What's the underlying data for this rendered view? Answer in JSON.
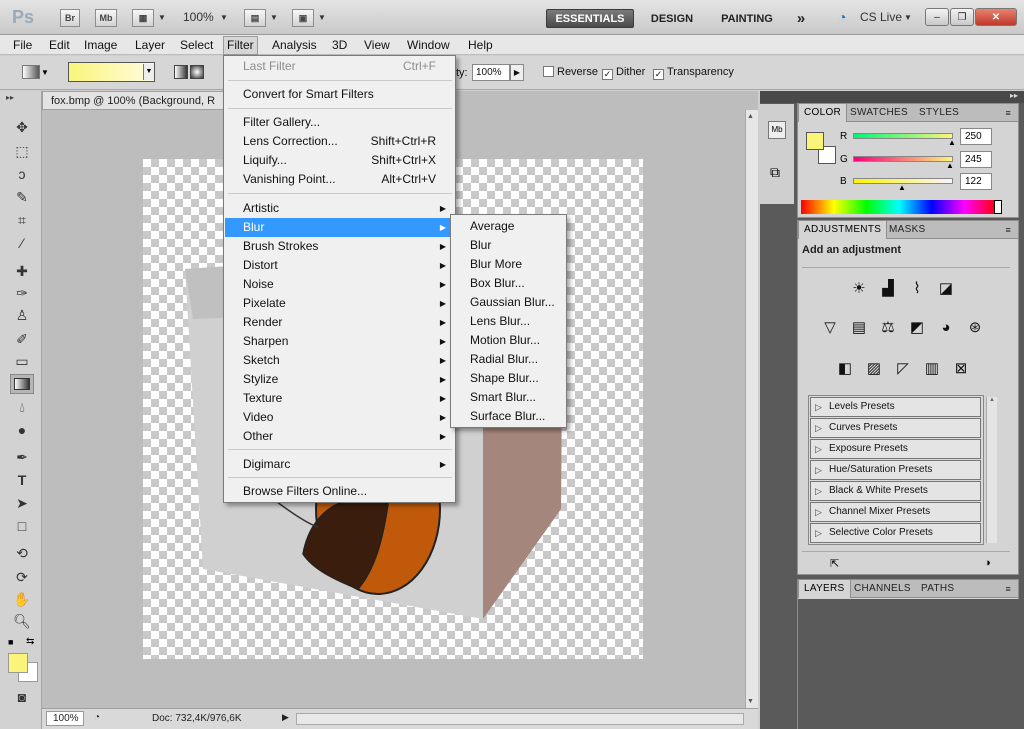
{
  "appbar": {
    "logo": "Ps",
    "bridge": "Br",
    "minibridge": "Mb",
    "zoom": "100%",
    "workspaces": [
      "ESSENTIALS",
      "DESIGN",
      "PAINTING"
    ],
    "more": "»",
    "cs_live": "CS Live",
    "win_min": "–",
    "win_restore": "❐",
    "win_close": "✕"
  },
  "menubar": {
    "items": [
      "File",
      "Edit",
      "Image",
      "Layer",
      "Select",
      "Filter",
      "Analysis",
      "3D",
      "View",
      "Window",
      "Help"
    ],
    "open": "Filter"
  },
  "options": {
    "opacity_label": "ty:",
    "opacity": "100%",
    "reverse": "Reverse",
    "dither": "Dither",
    "transparency": "Transparency",
    "reverse_checked": false,
    "dither_checked": true,
    "transparency_checked": true
  },
  "document": {
    "tab_title": "fox.bmp @ 100% (Background, R",
    "status_zoom": "100%",
    "status_doc": "Doc: 732,4K/976,6K"
  },
  "filter_menu": {
    "items": [
      {
        "label": "Last Filter",
        "shortcut": "Ctrl+F",
        "disabled": true
      },
      {
        "label": "Convert for Smart Filters",
        "shortcut": ""
      },
      {
        "label": "Filter Gallery...",
        "shortcut": ""
      },
      {
        "label": "Lens Correction...",
        "shortcut": "Shift+Ctrl+R"
      },
      {
        "label": "Liquify...",
        "shortcut": "Shift+Ctrl+X"
      },
      {
        "label": "Vanishing Point...",
        "shortcut": "Alt+Ctrl+V"
      },
      {
        "label": "Artistic",
        "submenu": true
      },
      {
        "label": "Blur",
        "submenu": true,
        "highlighted": true
      },
      {
        "label": "Brush Strokes",
        "submenu": true
      },
      {
        "label": "Distort",
        "submenu": true
      },
      {
        "label": "Noise",
        "submenu": true
      },
      {
        "label": "Pixelate",
        "submenu": true
      },
      {
        "label": "Render",
        "submenu": true
      },
      {
        "label": "Sharpen",
        "submenu": true
      },
      {
        "label": "Sketch",
        "submenu": true
      },
      {
        "label": "Stylize",
        "submenu": true
      },
      {
        "label": "Texture",
        "submenu": true
      },
      {
        "label": "Video",
        "submenu": true
      },
      {
        "label": "Other",
        "submenu": true
      },
      {
        "label": "Digimarc",
        "submenu": true
      },
      {
        "label": "Browse Filters Online...",
        "shortcut": ""
      }
    ]
  },
  "blur_submenu": {
    "items": [
      "Average",
      "Blur",
      "Blur More",
      "Box Blur...",
      "Gaussian Blur...",
      "Lens Blur...",
      "Motion Blur...",
      "Radial Blur...",
      "Shape Blur...",
      "Smart Blur...",
      "Surface Blur..."
    ]
  },
  "color_panel": {
    "tabs": [
      "COLOR",
      "SWATCHES",
      "STYLES"
    ],
    "r_label": "R",
    "g_label": "G",
    "b_label": "B",
    "r": "250",
    "g": "245",
    "b": "122",
    "foreground": "#faf57a",
    "background": "#ffffff"
  },
  "adjustments_panel": {
    "tabs": [
      "ADJUSTMENTS",
      "MASKS"
    ],
    "heading": "Add an adjustment",
    "icons_row1": [
      "brightness-icon",
      "levels-icon",
      "curves-icon",
      "exposure-icon"
    ],
    "icons_row2": [
      "vibrance-icon",
      "hue-saturation-icon",
      "color-balance-icon",
      "black-white-icon",
      "photo-filter-icon",
      "channel-mixer-icon"
    ],
    "icons_row3": [
      "invert-icon",
      "posterize-icon",
      "threshold-icon",
      "gradient-map-icon",
      "selective-color-icon"
    ],
    "presets": [
      "Levels Presets",
      "Curves Presets",
      "Exposure Presets",
      "Hue/Saturation Presets",
      "Black & White Presets",
      "Channel Mixer Presets",
      "Selective Color Presets"
    ]
  },
  "layers_panel": {
    "tabs": [
      "LAYERS",
      "CHANNELS",
      "PATHS"
    ]
  }
}
